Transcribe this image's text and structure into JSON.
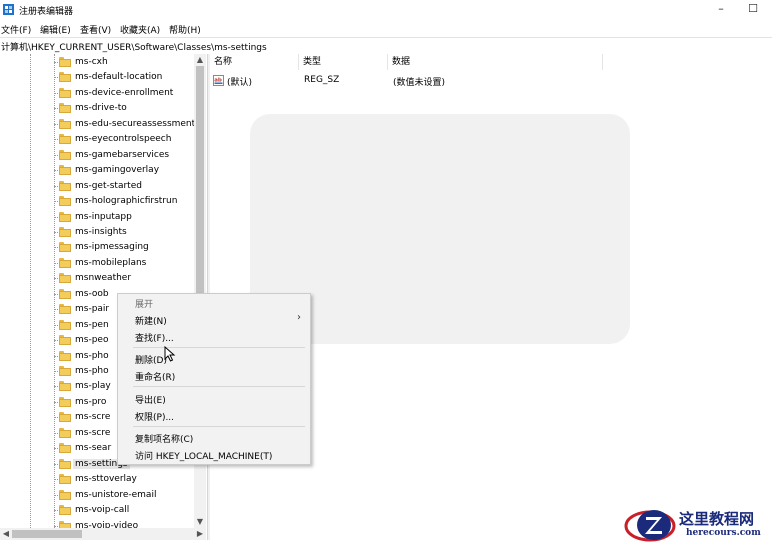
{
  "window": {
    "title": "注册表编辑器",
    "minimize_glyph": "–",
    "maximize_glyph": "☐"
  },
  "menubar": {
    "items": [
      "文件(F)",
      "编辑(E)",
      "查看(V)",
      "收藏夹(A)",
      "帮助(H)"
    ]
  },
  "address": {
    "path": "计算机\\HKEY_CURRENT_USER\\Software\\Classes\\ms-settings"
  },
  "tree": {
    "items": [
      "ms-cxh",
      "ms-default-location",
      "ms-device-enrollment",
      "ms-drive-to",
      "ms-edu-secureassessment",
      "ms-eyecontrolspeech",
      "ms-gamebarservices",
      "ms-gamingoverlay",
      "ms-get-started",
      "ms-holographicfirstrun",
      "ms-inputapp",
      "ms-insights",
      "ms-ipmessaging",
      "ms-mobileplans",
      "msnweather",
      "ms-oob",
      "ms-pair",
      "ms-pen",
      "ms-peo",
      "ms-pho",
      "ms-pho",
      "ms-play",
      "ms-pro",
      "ms-scre",
      "ms-scre",
      "ms-sear",
      "ms-settings",
      "ms-sttoverlay",
      "ms-unistore-email",
      "ms-voip-call",
      "ms-voip-video"
    ],
    "selected_index": 26,
    "scroll_up_glyph": "▲",
    "scroll_down_glyph": "▼",
    "scroll_left_glyph": "◀",
    "scroll_right_glyph": "▶"
  },
  "list": {
    "columns": [
      "名称",
      "类型",
      "数据"
    ],
    "rows": [
      {
        "icon": "string-value-icon",
        "name": "(默认)",
        "type": "REG_SZ",
        "data": "(数值未设置)"
      }
    ]
  },
  "context_menu": {
    "items": [
      {
        "label": "展开",
        "disabled": true,
        "submenu": false
      },
      {
        "label": "新建(N)",
        "disabled": false,
        "submenu": true
      },
      {
        "label": "查找(F)...",
        "disabled": false,
        "submenu": false
      },
      {
        "label": "删除(D)",
        "disabled": false,
        "submenu": false
      },
      {
        "label": "重命名(R)",
        "disabled": false,
        "submenu": false
      },
      {
        "label": "导出(E)",
        "disabled": false,
        "submenu": false
      },
      {
        "label": "权限(P)...",
        "disabled": false,
        "submenu": false
      },
      {
        "label": "复制项名称(C)",
        "disabled": false,
        "submenu": false
      },
      {
        "label": "访问 HKEY_LOCAL_MACHINE(T)",
        "disabled": false,
        "submenu": false
      }
    ],
    "submenu_glyph": "›"
  },
  "watermark": {
    "title": "这里教程网",
    "url": "herecours.com"
  },
  "colors": {
    "folder": "#f3cd5b",
    "logo_blue": "#1b2a7a",
    "logo_red": "#c8202a"
  }
}
